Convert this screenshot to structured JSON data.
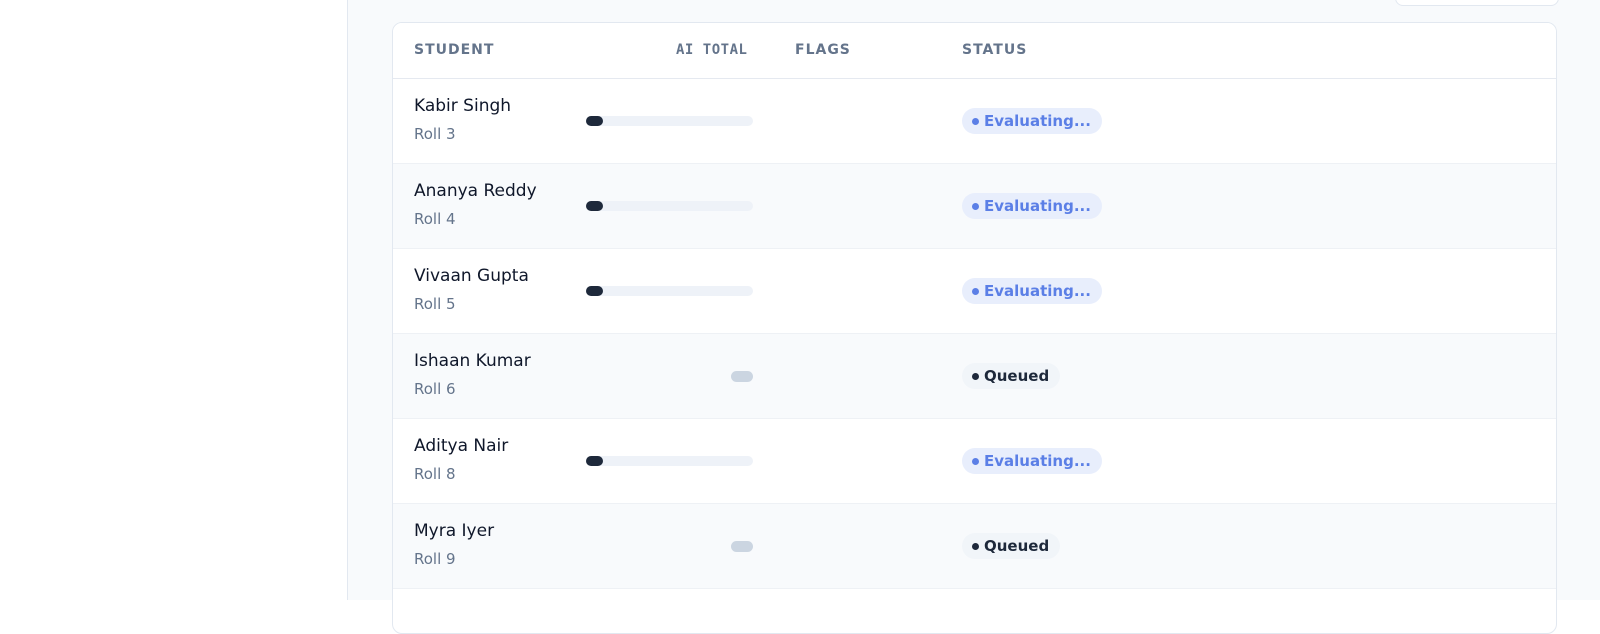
{
  "table": {
    "columns": {
      "student": "STUDENT",
      "ai_total": "AI TOTAL",
      "flags": "FLAGS",
      "status": "STATUS"
    },
    "rows": [
      {
        "name": "Kabir Singh",
        "roll": "Roll 3",
        "ai_total_progress": 0.1,
        "status": "Evaluating...",
        "status_kind": "evaluating"
      },
      {
        "name": "Ananya Reddy",
        "roll": "Roll 4",
        "ai_total_progress": 0.1,
        "status": "Evaluating...",
        "status_kind": "evaluating"
      },
      {
        "name": "Vivaan Gupta",
        "roll": "Roll 5",
        "ai_total_progress": 0.1,
        "status": "Evaluating...",
        "status_kind": "evaluating"
      },
      {
        "name": "Ishaan Kumar",
        "roll": "Roll 6",
        "ai_total_progress": null,
        "status": "Queued",
        "status_kind": "queued"
      },
      {
        "name": "Aditya Nair",
        "roll": "Roll 8",
        "ai_total_progress": 0.1,
        "status": "Evaluating...",
        "status_kind": "evaluating"
      },
      {
        "name": "Myra Iyer",
        "roll": "Roll 9",
        "ai_total_progress": null,
        "status": "Queued",
        "status_kind": "queued"
      }
    ]
  },
  "colors": {
    "evaluating": "#5b7fe6",
    "queued": "#1e293b",
    "progress_fill": "#1e293b",
    "progress_track": "#eef2f8"
  }
}
